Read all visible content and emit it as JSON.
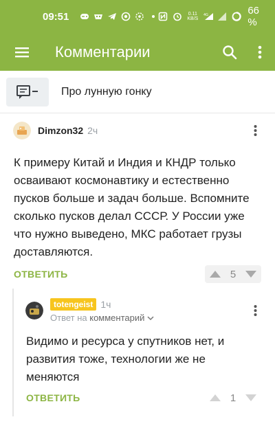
{
  "status_bar": {
    "time": "09:51",
    "net_speed": "0.11\nKB/S",
    "battery": "66 %"
  },
  "app_bar": {
    "title": "Комментарии",
    "icons": [
      "menu-icon",
      "search-icon",
      "more-vertical-icon"
    ]
  },
  "post": {
    "title": "Про лунную гонку"
  },
  "comments": [
    {
      "author": "Dimzon32",
      "time": "2ч",
      "text": "К примеру Китай и Индия и КНДР только осваивают космонавтику и естественно пусков больше и задач больше. Вспомните сколько пусков делал СССР. У России уже что нужно выведено, МКС работает грузы доставляются.",
      "reply_label": "ОТВЕТИТЬ",
      "votes": "5"
    },
    {
      "author": "totengeist",
      "time": "1ч",
      "reply_to_prefix": "Ответ на",
      "reply_to_target": "комментарий",
      "text": "Видимо и ресурса у спутников нет, и развития тоже, технологии же не меняются",
      "reply_label": "ОТВЕТИТЬ",
      "votes": "1"
    }
  ],
  "colors": {
    "brand_green": "#8cb543",
    "author_badge": "#f7c51e",
    "muted_gray": "#9aa0a6"
  }
}
